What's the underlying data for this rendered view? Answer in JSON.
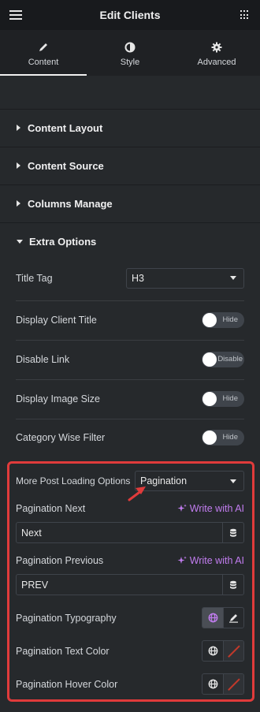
{
  "header": {
    "title": "Edit Clients",
    "menu_icon": "hamburger-icon",
    "apps_icon": "grid-icon"
  },
  "tabs": [
    {
      "label": "Content",
      "icon": "pencil-icon",
      "active": true
    },
    {
      "label": "Style",
      "icon": "half-circle-icon",
      "active": false
    },
    {
      "label": "Advanced",
      "icon": "gear-icon",
      "active": false
    }
  ],
  "sections": {
    "content_layout": "Content Layout",
    "content_source": "Content Source",
    "columns_manage": "Columns Manage",
    "extra_options": "Extra Options"
  },
  "extra_options": {
    "title_tag": {
      "label": "Title Tag",
      "value": "H3"
    },
    "display_client_title": {
      "label": "Display Client Title",
      "toggle": "Hide"
    },
    "disable_link": {
      "label": "Disable Link",
      "toggle": "Disable"
    },
    "display_image_size": {
      "label": "Display Image Size",
      "toggle": "Hide"
    },
    "category_wise_filter": {
      "label": "Category Wise Filter",
      "toggle": "Hide"
    },
    "more_post_loading": {
      "label": "More Post Loading Options",
      "value": "Pagination"
    },
    "pagination_next": {
      "label": "Pagination Next",
      "ai": "Write with AI",
      "value": "Next"
    },
    "pagination_previous": {
      "label": "Pagination Previous",
      "ai": "Write with AI",
      "value": "PREV"
    },
    "pagination_typography": {
      "label": "Pagination Typography"
    },
    "pagination_text_color": {
      "label": "Pagination Text Color"
    },
    "pagination_hover_color": {
      "label": "Pagination Hover Color"
    }
  },
  "colors": {
    "highlight": "#e03b3b",
    "ai_accent": "#c27df0",
    "bg": "#26292c"
  }
}
